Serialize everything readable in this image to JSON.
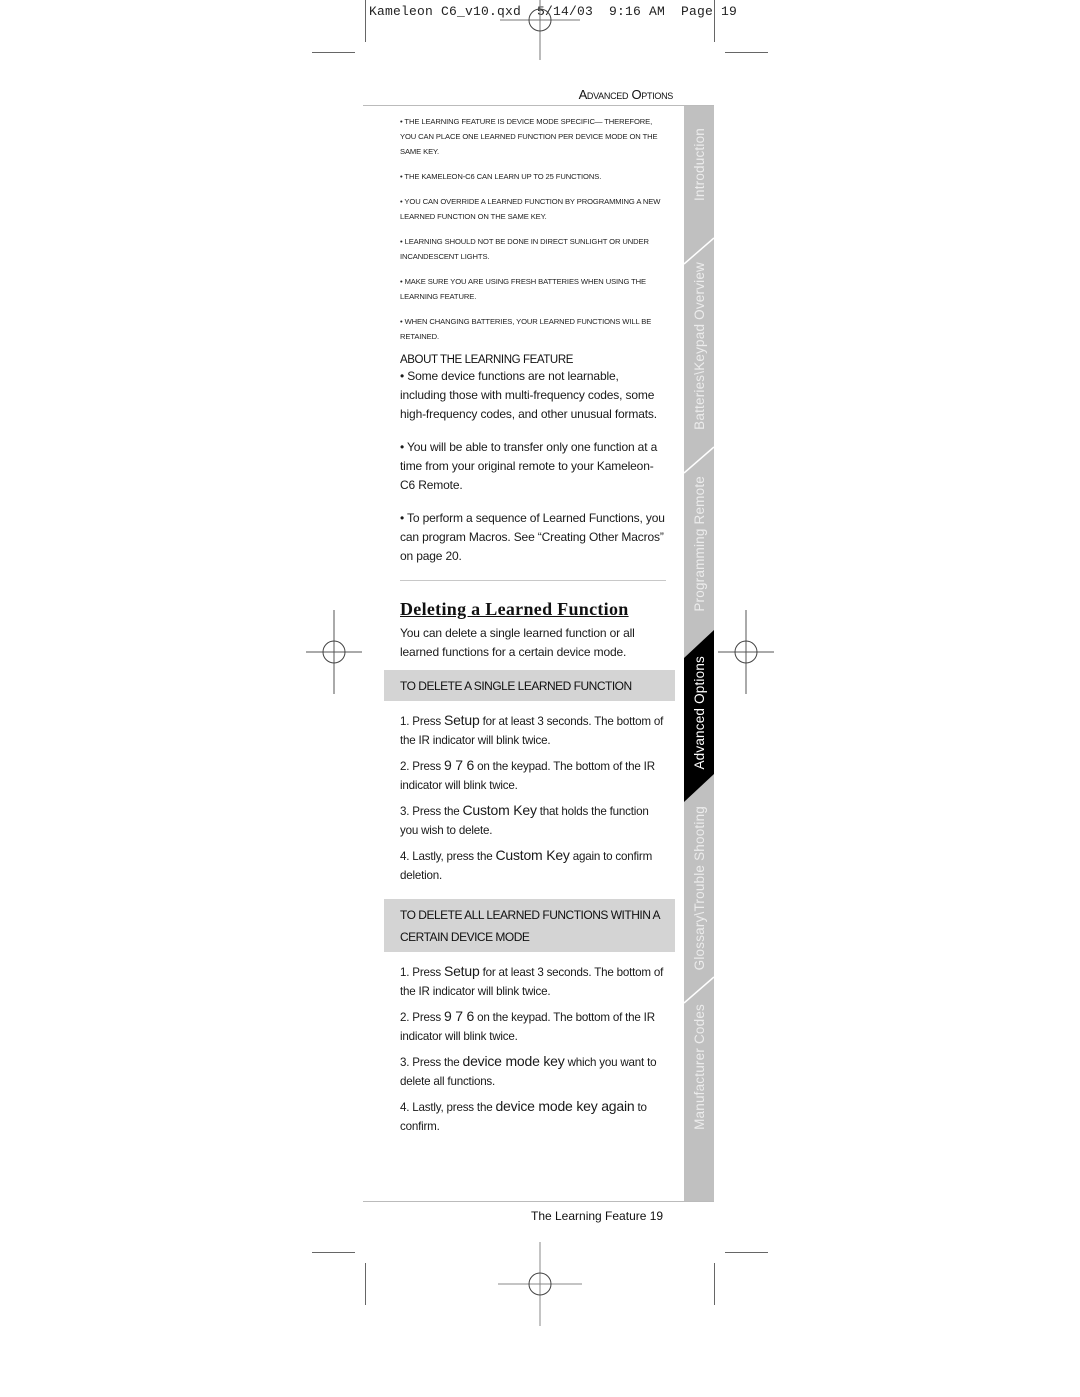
{
  "slug": "Kameleon C6_v10.qxd  5/14/03  9:16 AM  Page 19",
  "running_head": "Advanced Options",
  "notes": [
    "• The Learning Feature is device mode specific— therefore, you can place one Learned Function per device mode on the same key.",
    "• The Kameleon-C6 can learn up to 25 functions.",
    "• You can override a Learned Function by programming a new Learned Function on the same key.",
    "• Learning should not be done in direct sunlight or under incandescent lights.",
    "• Make sure you are using fresh batteries when using the Learning Feature.",
    "• When changing batteries, your Learned Functions will be retained."
  ],
  "about": {
    "heading": "About the Learning Feature",
    "paragraphs": [
      " • Some device functions are not learnable, including those with multi-frequency codes, some high-frequency codes, and other unusual formats.",
      "• You will be able to transfer only one function at a time from your original remote to your Kameleon-C6 Remote.",
      "• To perform a sequence of Learned Functions, you can program Macros. See “Creating Other Macros” on page 20."
    ]
  },
  "deleting": {
    "title": "Deleting a Learned Function",
    "intro": "You can delete a single learned function or all learned functions for a certain device mode.",
    "single": {
      "heading": "To delete a single learned function",
      "steps": [
        {
          "pre": "1. Press ",
          "key": "Setup",
          "post": " for at least 3 seconds. The bottom of the IR indicator will blink twice."
        },
        {
          "pre": "2. Press ",
          "key": "9 7 6",
          "post": " on the keypad. The bottom of the IR indicator will blink twice."
        },
        {
          "pre": "3. Press the ",
          "key": "Custom Key",
          "post": " that holds the function you wish to delete."
        },
        {
          "pre": "4.  Lastly, press the ",
          "key": "Custom Key",
          "post": " again to confirm deletion."
        }
      ]
    },
    "all": {
      "heading": "To delete all learned functions within a certain device mode",
      "steps": [
        {
          "pre": "1. Press ",
          "key": "Setup",
          "post": " for at least 3 seconds. The bottom of the IR indicator will blink twice."
        },
        {
          "pre": "2. Press ",
          "key": "9 7 6",
          "post": " on the keypad. The bottom of the IR indicator will blink twice."
        },
        {
          "pre": "3. Press the ",
          "key": "device mode key",
          "post": " which you want to delete all functions."
        },
        {
          "pre": "4. Lastly, press the ",
          "key": "device mode key again",
          "post": " to confirm."
        }
      ]
    }
  },
  "side_tabs": [
    {
      "label": "Introduction",
      "active": false
    },
    {
      "label": "Batteries\\Keypad Overview",
      "active": false
    },
    {
      "label": "Programming Remote",
      "active": false
    },
    {
      "label": "Advanced Options",
      "active": true
    },
    {
      "label": "Glossary\\Trouble Shooting",
      "active": false
    },
    {
      "label": "Manufacturer Codes",
      "active": false
    }
  ],
  "footer": "The Learning Feature 19"
}
